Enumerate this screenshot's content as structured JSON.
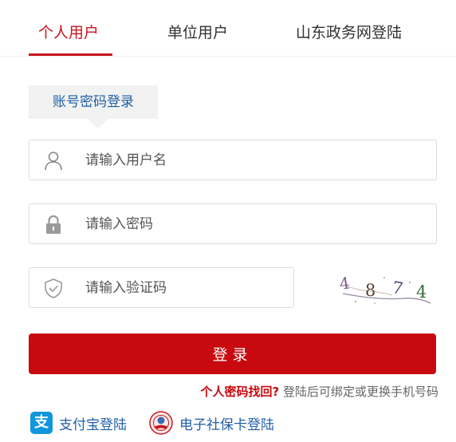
{
  "tabs": [
    {
      "label": "个人用户",
      "active": true
    },
    {
      "label": "单位用户",
      "active": false
    },
    {
      "label": "山东政务网登陆",
      "active": false
    }
  ],
  "subtab": {
    "label": "账号密码登录"
  },
  "form": {
    "username": {
      "placeholder": "请输入用户名",
      "value": "",
      "icon": "user-icon"
    },
    "password": {
      "placeholder": "请输入密码",
      "value": "",
      "icon": "lock-icon"
    },
    "captcha": {
      "placeholder": "请输入验证码",
      "value": "",
      "icon": "shield-icon",
      "image_text": "4 8 7 4"
    },
    "login_label": "登录"
  },
  "recover": {
    "link": "个人密码找回?",
    "hint": "登陆后可绑定或更换手机号码"
  },
  "alt_logins": [
    {
      "label": "支付宝登陆",
      "icon": "alipay-icon"
    },
    {
      "label": "电子社保卡登陆",
      "icon": "social-security-card-icon"
    }
  ],
  "colors": {
    "accent": "#c8161d",
    "button": "#c8090f",
    "link_blue": "#1f5fa6",
    "alipay_blue": "#1296db"
  }
}
